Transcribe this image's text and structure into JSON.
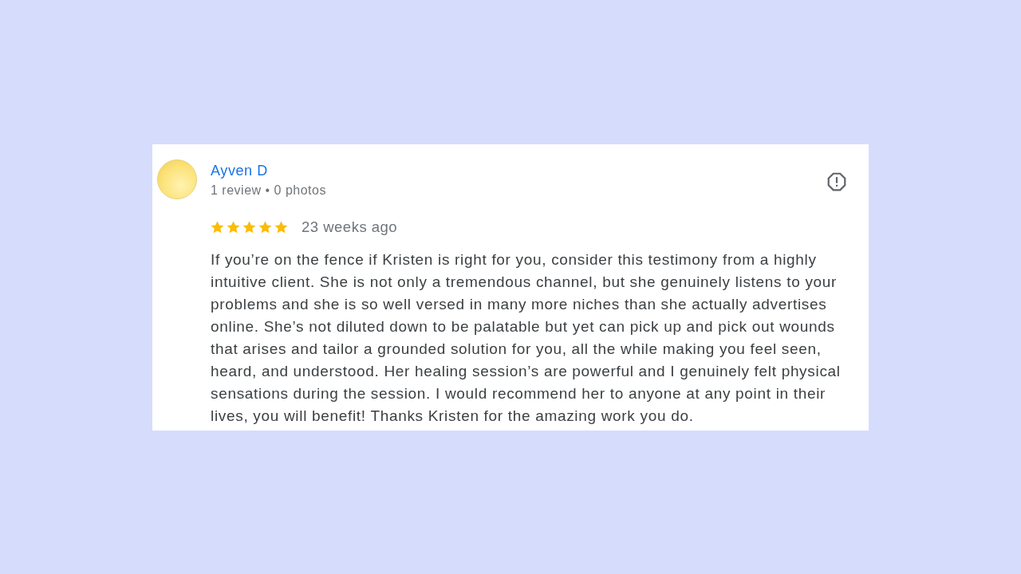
{
  "review": {
    "author": "Ayven D",
    "meta": "1 review • 0 photos",
    "stars": 5,
    "time": "23 weeks ago",
    "text": "If you’re on the fence if Kristen is right for you, consider this testimony from a highly intuitive client. She is not only a tremendous channel, but she genuinely listens to your problems and she is so well versed in many more niches than she actually advertises online. She’s not diluted down to be palatable but yet can pick up and pick out wounds that arises and tailor a grounded solution for you, all the while making you feel seen, heard, and understood. Her healing session’s are powerful and I genuinely felt physical sensations during the session. I would recommend her to anyone at any point in their lives, you will benefit! Thanks Kristen for the amazing work you do."
  }
}
